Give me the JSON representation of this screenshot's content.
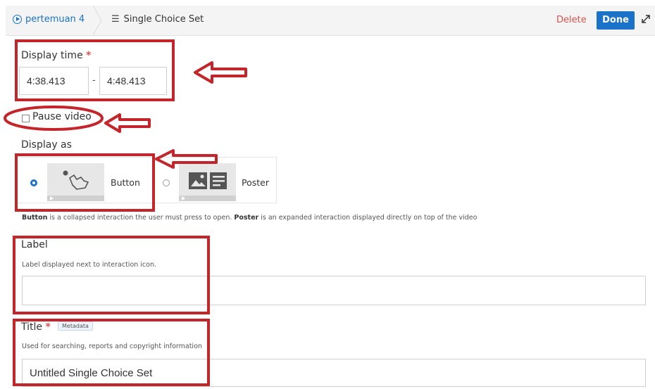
{
  "breadcrumb": {
    "video": "pertemuan 4",
    "interaction": "Single Choice Set"
  },
  "actions": {
    "delete": "Delete",
    "done": "Done"
  },
  "display_time": {
    "label": "Display time",
    "required": "*",
    "start": "4:38.413",
    "separator": "-",
    "end": "4:48.413"
  },
  "pause_video": {
    "label": "Pause video",
    "checked": false
  },
  "display_as": {
    "label": "Display as",
    "options": [
      {
        "label": "Button",
        "selected": true,
        "icon": "hand-pointer-icon"
      },
      {
        "label": "Poster",
        "selected": false,
        "icon": "image-text-icon"
      }
    ],
    "description": {
      "button_word": "Button",
      "text1": " is a collapsed interaction the user must press to open. ",
      "poster_word": "Poster",
      "text2": " is an expanded interaction displayed directly on top of the video"
    }
  },
  "label_field": {
    "label": "Label",
    "description": "Label displayed next to interaction icon.",
    "value": ""
  },
  "title_field": {
    "label": "Title",
    "required": "*",
    "tag": "Metadata",
    "description": "Used for searching, reports and copyright information",
    "value": "Untitled Single Choice Set"
  },
  "colors": {
    "annotation": "#c3252a",
    "accent": "#1a73c9",
    "delete": "#d9534f"
  }
}
